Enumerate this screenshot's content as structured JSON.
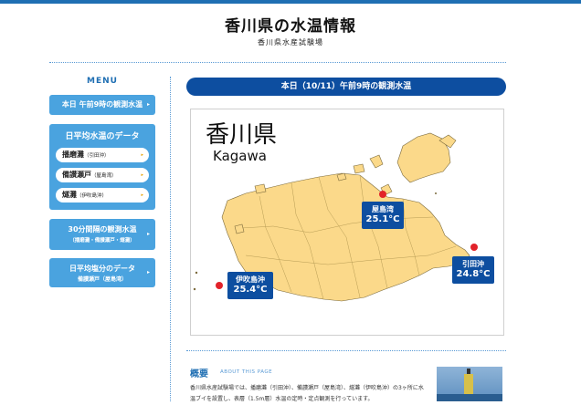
{
  "header": {
    "title": "香川県の水温情報",
    "subtitle": "香川県水産試験場"
  },
  "menu": {
    "title": "MENU",
    "today_obs": "本日 午前9時の観測水温",
    "daily_avg": "日平均水温のデータ",
    "sub_items": [
      {
        "label": "播磨灘",
        "note": "（引田沖）"
      },
      {
        "label": "備讃瀬戸",
        "note": "（屋島湾）"
      },
      {
        "label": "燧灘",
        "note": "（伊吹島沖）"
      }
    ],
    "interval": {
      "line1": "30分間隔の観測水温",
      "line2": "（播磨灘・備讃瀬戸・燧灘）"
    },
    "salinity": {
      "line1": "日平均塩分のデータ",
      "line2": "備讃瀬戸（屋島湾）"
    }
  },
  "main": {
    "banner": "本日（10/11）午前9時の観測水温",
    "map_title_jp": "香川県",
    "map_title_en": "Kagawa",
    "stations": [
      {
        "name": "屋島湾",
        "temp": "25.1°C"
      },
      {
        "name": "引田沖",
        "temp": "24.8°C"
      },
      {
        "name": "伊吹島沖",
        "temp": "25.4°C"
      }
    ]
  },
  "about": {
    "heading": "概要",
    "heading_en": "ABOUT THIS PAGE",
    "text": "香川県水産試験場では、播磨灘（引田沖）、備讃瀬戸（屋島湾）、燧灘（伊吹島沖）の3ヶ所に水温ブイを設置し、表層（1.5m層）水温の定時・定点観測を行っています。"
  },
  "colors": {
    "accent": "#1f6fb3",
    "menu_button": "#4aa3df",
    "banner": "#0d4ea0",
    "land": "#fbd98a",
    "marker": "#e2232a"
  }
}
